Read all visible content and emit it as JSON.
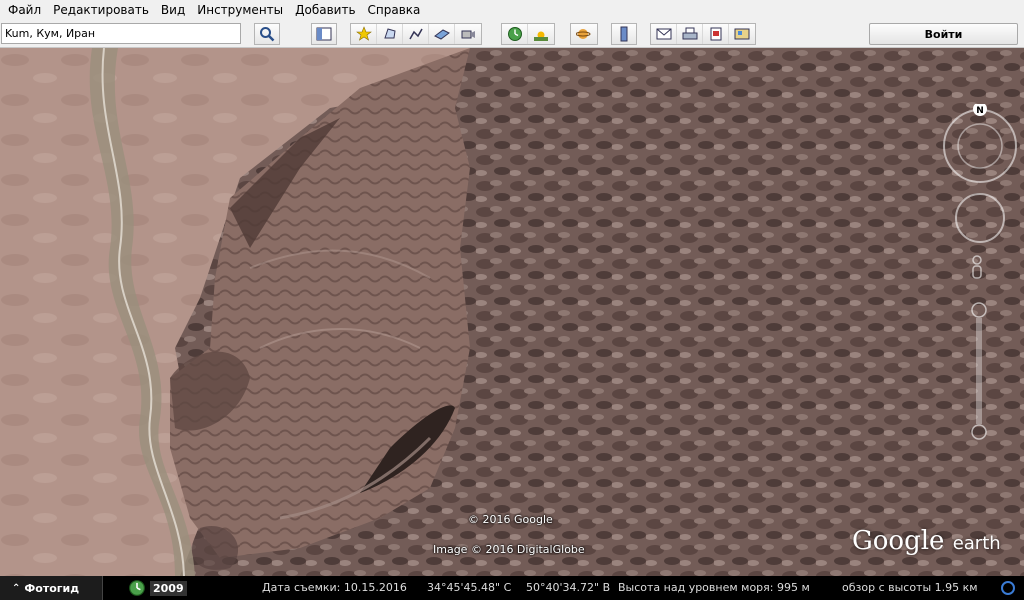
{
  "menu": [
    "Файл",
    "Редактировать",
    "Вид",
    "Инструменты",
    "Добавить",
    "Справка"
  ],
  "search": {
    "value": "Kum, Кум, Иран"
  },
  "toolbar": {
    "login_label": "Войти",
    "icons": [
      "search-icon",
      "sidebar-toggle-icon",
      "placemark-icon",
      "polygon-icon",
      "path-icon",
      "image-overlay-icon",
      "record-tour-icon",
      "historical-imagery-icon",
      "sunlight-icon",
      "planets-icon",
      "ruler-icon",
      "email-icon",
      "print-icon",
      "save-image-icon",
      "view-in-maps-icon"
    ]
  },
  "map": {
    "copyright_google": "© 2016 Google",
    "copyright_imagery": "Image © 2016 DigitalGlobe",
    "logo_google": "Google",
    "logo_earth": "earth",
    "compass_label": "N"
  },
  "status": {
    "tour_guide": "Фотогид",
    "year": "2009",
    "date_label": "Дата съемки: 10.15.2016",
    "lat": "34°45'45.48\" С",
    "lon": "50°40'34.72\" В",
    "elevation": "Высота над уровнем моря:  995 м",
    "eye_alt": "обзор с высоты   1.95 км"
  },
  "colors": {
    "desert": "#b5968a",
    "badlands": "#6f5853",
    "statusbar": "#000000"
  }
}
